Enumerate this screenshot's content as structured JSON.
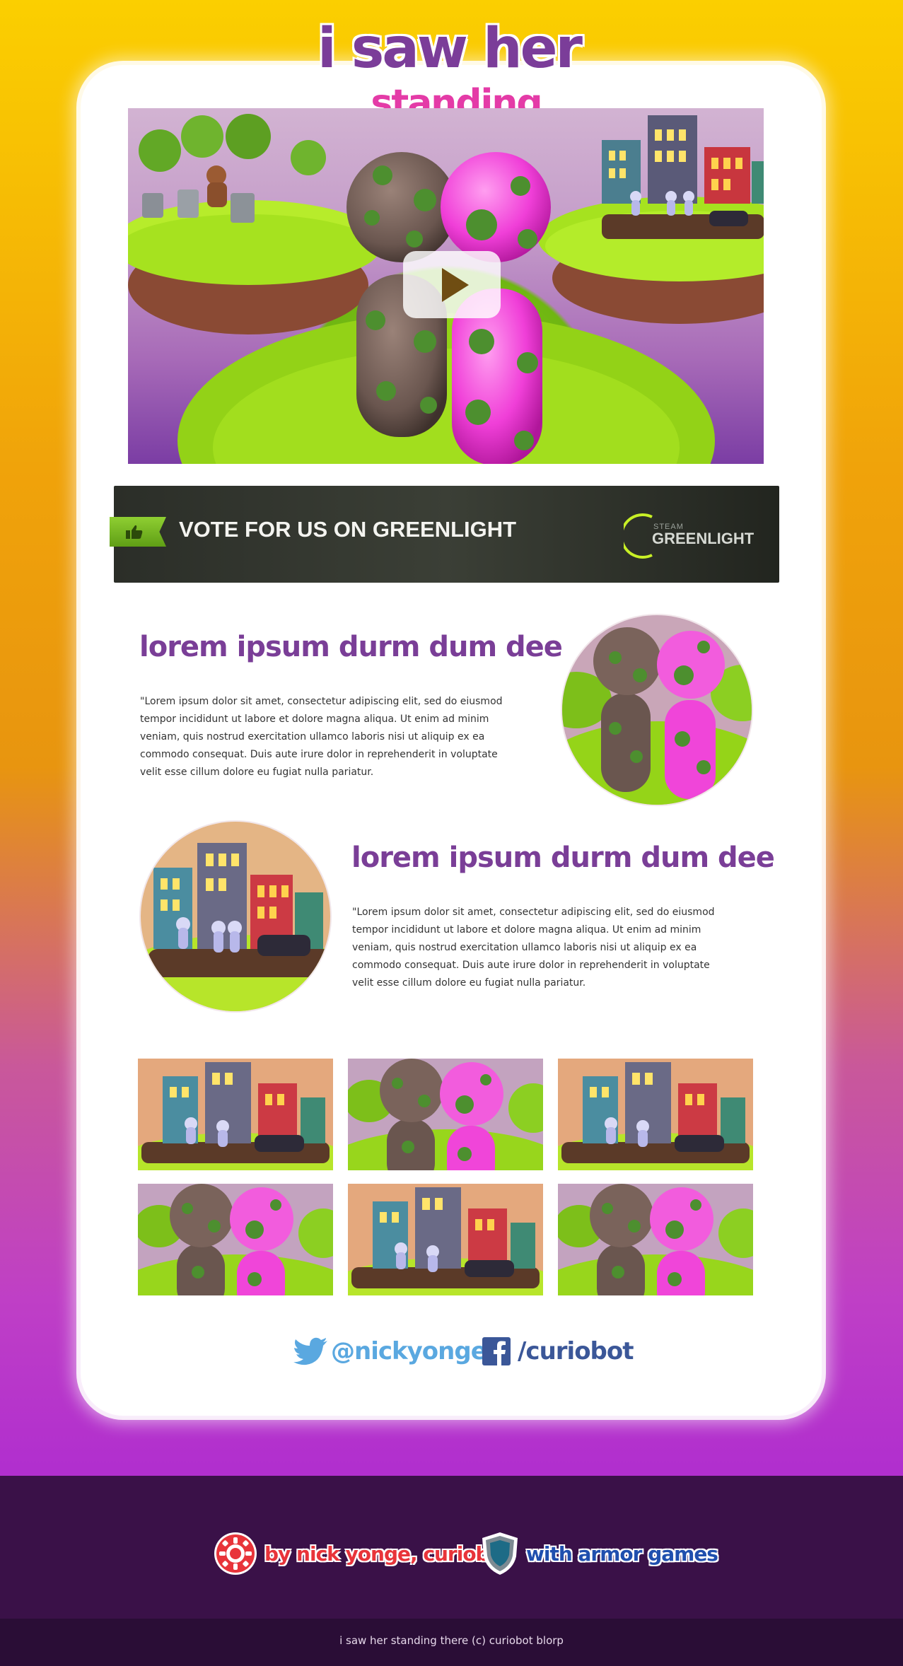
{
  "logo": {
    "line1": "i saw her",
    "line2": "standing there"
  },
  "hero": {
    "play_label": "Play video"
  },
  "greenlight": {
    "text": "VOTE FOR US ON GREENLIGHT",
    "steam": "STEAM",
    "greenlight": "GREENLIGHT"
  },
  "features": [
    {
      "title": "lorem ipsum durm dum dee",
      "body": "\"Lorem ipsum dolor sit amet, consectetur adipiscing elit, sed do eiusmod tempor incididunt ut labore et dolore magna aliqua. Ut enim ad minim veniam, quis nostrud exercitation ullamco laboris nisi ut aliquip ex ea commodo consequat. Duis aute irure dolor in reprehenderit in voluptate velit esse cillum dolore eu fugiat nulla pariatur."
    },
    {
      "title": "lorem ipsum durm dum dee",
      "body": "\"Lorem ipsum dolor sit amet, consectetur adipiscing elit, sed do eiusmod tempor incididunt ut labore et dolore magna aliqua. Ut enim ad minim veniam, quis nostrud exercitation ullamco laboris nisi ut aliquip ex ea commodo consequat. Duis aute irure dolor in reprehenderit in voluptate velit esse cillum dolore eu fugiat nulla pariatur."
    }
  ],
  "thumbnails": [
    "town",
    "characters",
    "town",
    "characters",
    "town",
    "characters"
  ],
  "social": {
    "twitter": "@nickyonge",
    "facebook": "/curiobot"
  },
  "credits": {
    "author": "by nick yonge, curiobot",
    "publisher": "with armor games"
  },
  "footer": {
    "copyright": "i saw her standing there (c) curiobot blorp"
  },
  "colors": {
    "purple": "#7a3e97",
    "pink": "#e43ba7",
    "twitter": "#5aa8e0",
    "facebook": "#3b5798",
    "credit_red": "#e8343a",
    "credit_blue": "#1f4fae"
  }
}
